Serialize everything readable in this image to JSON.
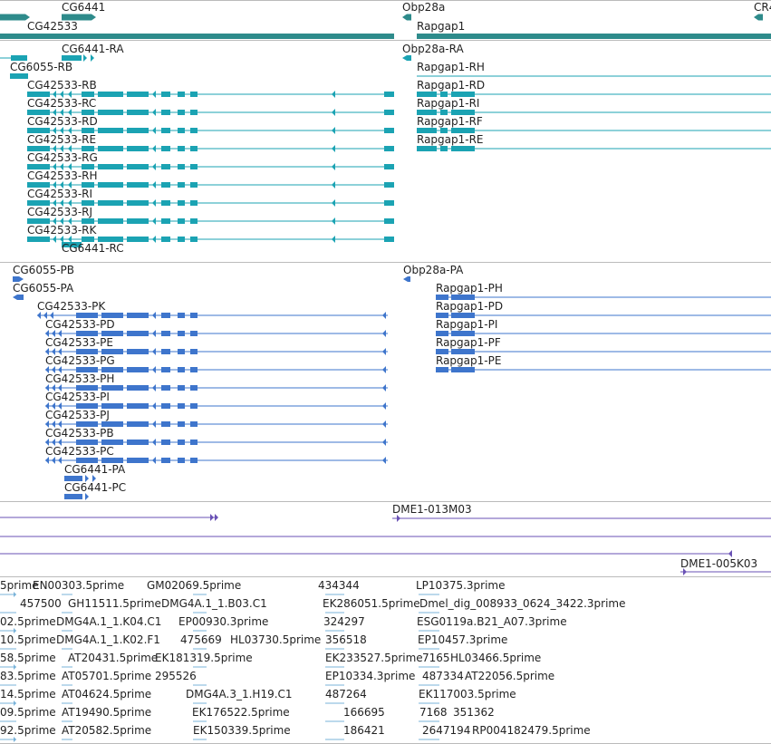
{
  "colors": {
    "gene": "#2e8b8b",
    "transcript": "#1ba3b3",
    "protein": "#3e75cc",
    "clone": "#6a52b5",
    "est": "#7ab3d9",
    "divider": "#bbbbbb",
    "text": "#222222"
  },
  "tracks": {
    "genes": {
      "labels": [
        {
          "id": "gene-cg6441",
          "text": "CG6441"
        },
        {
          "id": "gene-cg42533",
          "text": "CG42533"
        },
        {
          "id": "gene-obp28a",
          "text": "Obp28a"
        },
        {
          "id": "gene-rapgap1",
          "text": "Rapgap1"
        },
        {
          "id": "gene-cr",
          "text": "CR4"
        }
      ]
    },
    "transcripts": {
      "labels": [
        {
          "id": "tx-cg6441-ra",
          "text": "CG6441-RA"
        },
        {
          "id": "tx-obp28a-ra",
          "text": "Obp28a-RA"
        },
        {
          "id": "tx-cg6055-rb",
          "text": "CG6055-RB"
        },
        {
          "id": "tx-rapgap1-rh",
          "text": "Rapgap1-RH"
        },
        {
          "id": "tx-cg42533-rb",
          "text": "CG42533-RB"
        },
        {
          "id": "tx-rapgap1-rd",
          "text": "Rapgap1-RD"
        },
        {
          "id": "tx-cg42533-rc",
          "text": "CG42533-RC"
        },
        {
          "id": "tx-rapgap1-ri",
          "text": "Rapgap1-RI"
        },
        {
          "id": "tx-cg42533-rd",
          "text": "CG42533-RD"
        },
        {
          "id": "tx-rapgap1-rf",
          "text": "Rapgap1-RF"
        },
        {
          "id": "tx-cg42533-re",
          "text": "CG42533-RE"
        },
        {
          "id": "tx-rapgap1-re",
          "text": "Rapgap1-RE"
        },
        {
          "id": "tx-cg42533-rg",
          "text": "CG42533-RG"
        },
        {
          "id": "tx-cg42533-rh",
          "text": "CG42533-RH"
        },
        {
          "id": "tx-cg42533-ri",
          "text": "CG42533-RI"
        },
        {
          "id": "tx-cg42533-rj",
          "text": "CG42533-RJ"
        },
        {
          "id": "tx-cg42533-rk",
          "text": "CG42533-RK"
        },
        {
          "id": "tx-cg6441-rc",
          "text": "CG6441-RC"
        }
      ]
    },
    "proteins": {
      "labels": [
        {
          "id": "pp-cg6055-pb",
          "text": "CG6055-PB"
        },
        {
          "id": "pp-obp28a-pa",
          "text": "Obp28a-PA"
        },
        {
          "id": "pp-cg6055-pa",
          "text": "CG6055-PA"
        },
        {
          "id": "pp-rapgap1-ph",
          "text": "Rapgap1-PH"
        },
        {
          "id": "pp-cg42533-pk",
          "text": "CG42533-PK"
        },
        {
          "id": "pp-rapgap1-pd",
          "text": "Rapgap1-PD"
        },
        {
          "id": "pp-cg42533-pd",
          "text": "CG42533-PD"
        },
        {
          "id": "pp-rapgap1-pi",
          "text": "Rapgap1-PI"
        },
        {
          "id": "pp-cg42533-pe",
          "text": "CG42533-PE"
        },
        {
          "id": "pp-rapgap1-pf",
          "text": "Rapgap1-PF"
        },
        {
          "id": "pp-cg42533-pg",
          "text": "CG42533-PG"
        },
        {
          "id": "pp-rapgap1-pe",
          "text": "Rapgap1-PE"
        },
        {
          "id": "pp-cg42533-ph",
          "text": "CG42533-PH"
        },
        {
          "id": "pp-cg42533-pi",
          "text": "CG42533-PI"
        },
        {
          "id": "pp-cg42533-pj",
          "text": "CG42533-PJ"
        },
        {
          "id": "pp-cg42533-pb",
          "text": "CG42533-PB"
        },
        {
          "id": "pp-cg42533-pc",
          "text": "CG42533-PC"
        },
        {
          "id": "pp-cg6441-pa",
          "text": "CG6441-PA"
        },
        {
          "id": "pp-cg6441-pc",
          "text": "CG6441-PC"
        }
      ]
    },
    "clones": {
      "labels": [
        {
          "id": "clone-dme1-013m03",
          "text": "DME1-013M03"
        },
        {
          "id": "clone-dme1-005k03",
          "text": "DME1-005K03"
        }
      ]
    },
    "ests": {
      "labels": [
        {
          "id": "est-1",
          "text": "5prime"
        },
        {
          "id": "est-2",
          "text": "EN00303.5prime"
        },
        {
          "id": "est-3",
          "text": "GM02069.5prime"
        },
        {
          "id": "est-4",
          "text": "434344"
        },
        {
          "id": "est-5",
          "text": "LP10375.3prime"
        },
        {
          "id": "est-6",
          "text": "457500"
        },
        {
          "id": "est-7",
          "text": "GH11511.5prime"
        },
        {
          "id": "est-8",
          "text": "DMG4A.1_1.B03.C1"
        },
        {
          "id": "est-9",
          "text": "EK286051.5prime"
        },
        {
          "id": "est-10",
          "text": "Dmel_dig_008933_0624_3422.3prime"
        },
        {
          "id": "est-11",
          "text": "02.5prime"
        },
        {
          "id": "est-12",
          "text": "DMG4A.1_1.K04.C1"
        },
        {
          "id": "est-13",
          "text": "EP00930.3prime"
        },
        {
          "id": "est-14",
          "text": "324297"
        },
        {
          "id": "est-15",
          "text": "ESG0119a.B21_A07.3prime"
        },
        {
          "id": "est-16",
          "text": "10.5prime"
        },
        {
          "id": "est-17",
          "text": "DMG4A.1_1.K02.F1"
        },
        {
          "id": "est-18",
          "text": "475669"
        },
        {
          "id": "est-19",
          "text": "HL03730.5prime"
        },
        {
          "id": "est-20",
          "text": "356518"
        },
        {
          "id": "est-21",
          "text": "EP10457.3prime"
        },
        {
          "id": "est-22",
          "text": "58.5prime"
        },
        {
          "id": "est-23",
          "text": "AT20431.5prime"
        },
        {
          "id": "est-24",
          "text": "EK181319.5prime"
        },
        {
          "id": "est-25",
          "text": "EK233527.5prime"
        },
        {
          "id": "est-26",
          "text": "7165"
        },
        {
          "id": "est-27",
          "text": "HL03466.5prime"
        },
        {
          "id": "est-28",
          "text": "83.5prime"
        },
        {
          "id": "est-29",
          "text": "AT05701.5prime"
        },
        {
          "id": "est-30",
          "text": "295526"
        },
        {
          "id": "est-31",
          "text": "EP10334.3prime"
        },
        {
          "id": "est-32",
          "text": "487334"
        },
        {
          "id": "est-33",
          "text": "AT22056.5prime"
        },
        {
          "id": "est-34",
          "text": "14.5prime"
        },
        {
          "id": "est-35",
          "text": "AT04624.5prime"
        },
        {
          "id": "est-36",
          "text": "DMG4A.3_1.H19.C1"
        },
        {
          "id": "est-37",
          "text": "487264"
        },
        {
          "id": "est-38",
          "text": "EK117003.5prime"
        },
        {
          "id": "est-39",
          "text": "09.5prime"
        },
        {
          "id": "est-40",
          "text": "AT19490.5prime"
        },
        {
          "id": "est-41",
          "text": "EK176522.5prime"
        },
        {
          "id": "est-42",
          "text": "166695"
        },
        {
          "id": "est-43",
          "text": "7168"
        },
        {
          "id": "est-44",
          "text": "351362"
        },
        {
          "id": "est-45",
          "text": "92.5prime"
        },
        {
          "id": "est-46",
          "text": "AT20582.5prime"
        },
        {
          "id": "est-47",
          "text": "EK150339.5prime"
        },
        {
          "id": "est-48",
          "text": "186421"
        },
        {
          "id": "est-49",
          "text": "2647194"
        },
        {
          "id": "est-50",
          "text": "RP004182479.5prime"
        }
      ]
    }
  }
}
